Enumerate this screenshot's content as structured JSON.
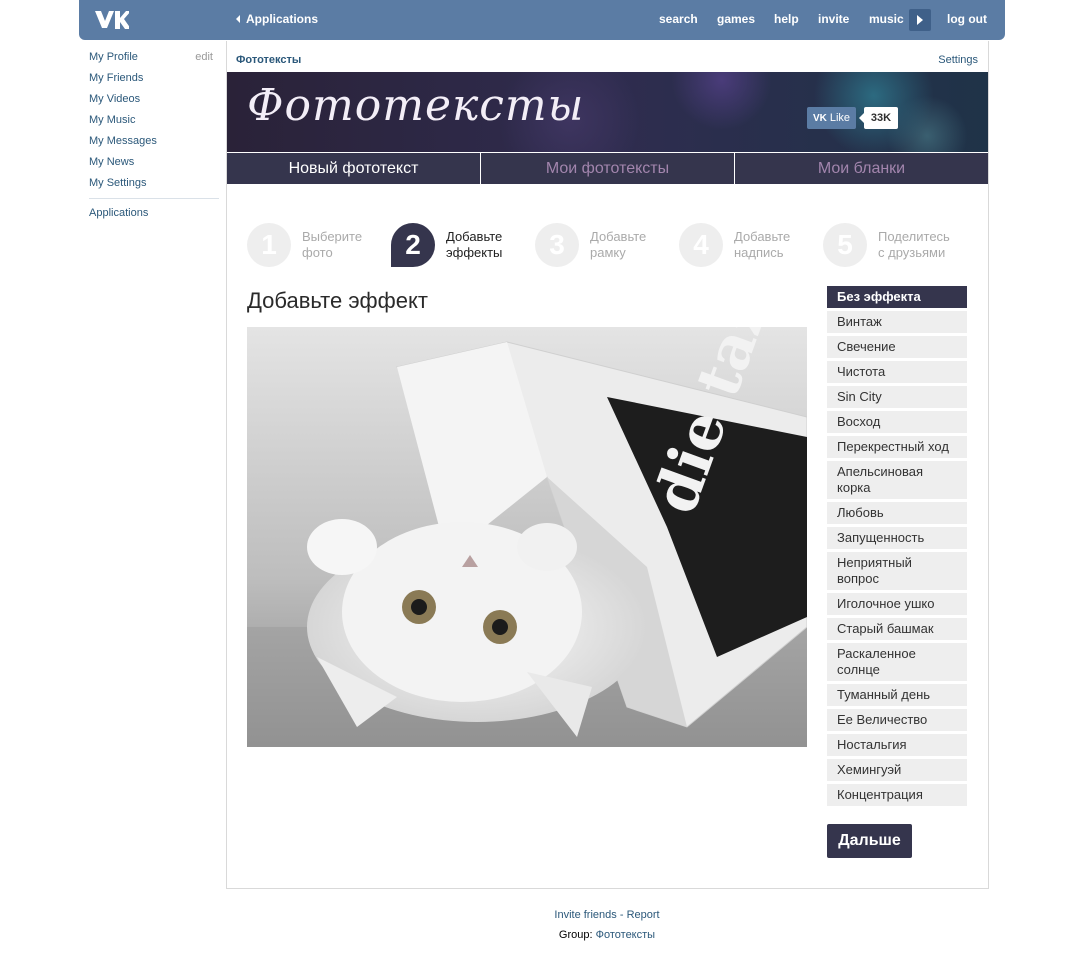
{
  "topbar": {
    "logo": "vk-logo",
    "back_label": "Applications",
    "nav": [
      "search",
      "games",
      "help",
      "invite",
      "music"
    ],
    "logout": "log out",
    "color": "#5b7ca4"
  },
  "sidebar": {
    "items": [
      "My Profile",
      "My Friends",
      "My Videos",
      "My Music",
      "My Messages",
      "My News",
      "My Settings"
    ],
    "edit": "edit",
    "applications": "Applications"
  },
  "app": {
    "crumb": "Фототексты",
    "settings": "Settings",
    "banner_title": "Фототексты",
    "like_label": "Like",
    "like_count": "33K",
    "tabs": [
      "Новый фототекст",
      "Мои фототексты",
      "Мои бланки"
    ],
    "steps": [
      {
        "num": "1",
        "line1": "Выберите",
        "line2": "фото"
      },
      {
        "num": "2",
        "line1": "Добавьте",
        "line2": "эффекты"
      },
      {
        "num": "3",
        "line1": "Добавьте",
        "line2": "рамку"
      },
      {
        "num": "4",
        "line1": "Добавьте",
        "line2": "надпись"
      },
      {
        "num": "5",
        "line1": "Поделитесь",
        "line2": "с друзьями"
      }
    ],
    "active_step": 2,
    "heading": "Добавьте эффект",
    "effects": [
      "Без эффекта",
      "Винтаж",
      "Свечение",
      "Чистота",
      "Sin City",
      "Восход",
      "Перекрестный ход",
      "Апельсиновая корка",
      "Любовь",
      "Запущенность",
      "Неприятный вопрос",
      "Иголочное ушко",
      "Старый башмак",
      "Раскаленное солнце",
      "Туманный день",
      "Ее Величество",
      "Ностальгия",
      "Хемингуэй",
      "Концентрация"
    ],
    "selected_effect": "Без эффекта",
    "next_label": "Дальше",
    "accent": "#35354d"
  },
  "footer": {
    "invite": "Invite friends",
    "sep": "-",
    "report": "Report",
    "group_label": "Group:",
    "group_link": "Фототексты"
  }
}
